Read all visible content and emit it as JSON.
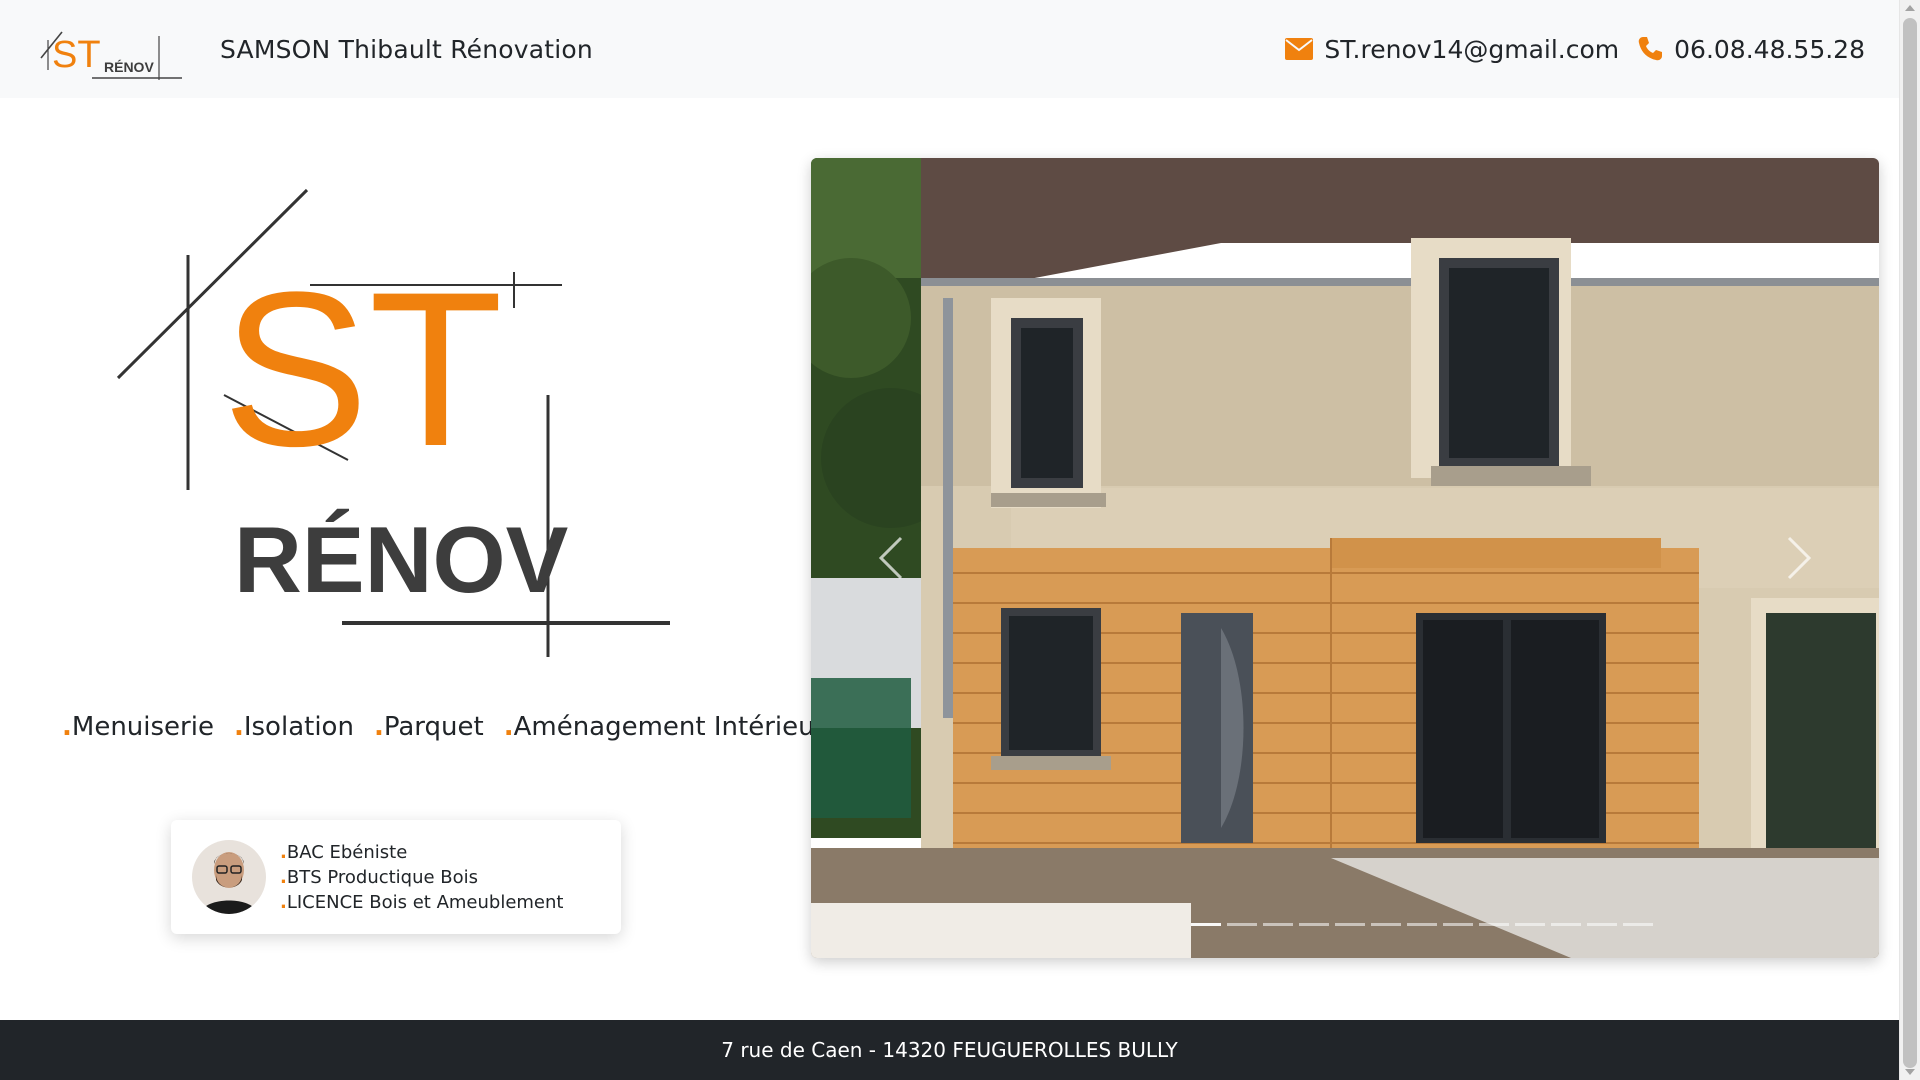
{
  "header": {
    "brand_logo_text": "ST RÉNOV",
    "brand_name": "SAMSON Thibault Rénovation",
    "email": "ST.renov14@gmail.com",
    "phone": "06.08.48.55.28"
  },
  "logo": {
    "letters": "ST",
    "subtitle": "RÉNOV"
  },
  "services": [
    "Menuiserie",
    "Isolation",
    "Parquet",
    "Aménagement Intérieur"
  ],
  "credentials": [
    "BAC Ebéniste",
    "BTS Productique Bois",
    "LICENCE Bois et Ameublement"
  ],
  "footer": {
    "address": "7 rue de Caen - 14320 FEUGUEROLLES BULLY"
  },
  "colors": {
    "accent": "#f0810e",
    "dark": "#3d3d3d",
    "header_bg": "#f8f9fa",
    "footer_bg": "#212529"
  },
  "icons": {
    "email": "envelope-icon",
    "phone": "phone-icon",
    "prev": "chevron-left-icon",
    "next": "chevron-right-icon"
  }
}
